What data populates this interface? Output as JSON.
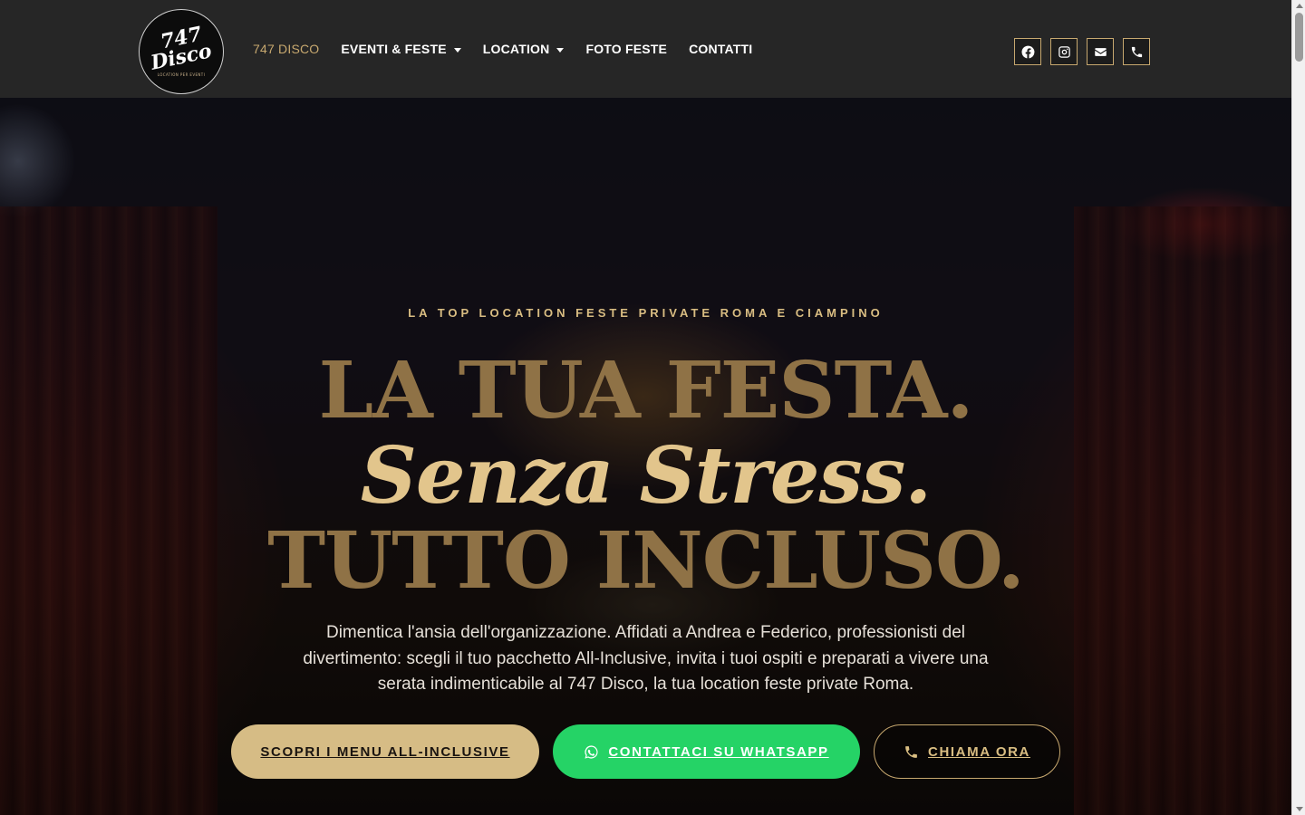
{
  "logo": {
    "line1": "747",
    "line2": "Disco",
    "tagline": "LOCATION PER EVENTI"
  },
  "nav": {
    "items": [
      {
        "label": "747 DISCO",
        "active": true,
        "dropdown": false
      },
      {
        "label": "EVENTI & FESTE",
        "active": false,
        "dropdown": true
      },
      {
        "label": "LOCATION",
        "active": false,
        "dropdown": true
      },
      {
        "label": "FOTO FESTE",
        "active": false,
        "dropdown": false
      },
      {
        "label": "CONTATTI",
        "active": false,
        "dropdown": false
      }
    ]
  },
  "socials": [
    "facebook-icon",
    "instagram-icon",
    "envelope-icon",
    "phone-icon"
  ],
  "hero": {
    "kicker": "LA TOP LOCATION FESTE PRIVATE ROMA E CIAMPINO",
    "headline1": "LA TUA FESTA.",
    "headline2": "Senza Stress.",
    "headline3": "TUTTO INCLUSO.",
    "description": "Dimentica l'ansia dell'organizzazione. Affidati a Andrea e Federico, professionisti del divertimento: scegli il tuo pacchetto All-Inclusive, invita i tuoi ospiti e preparati a vivere una serata indimenticabile al 747 Disco, la tua location feste private Roma."
  },
  "buttons": {
    "menu": "SCOPRI I MENU ALL-INCLUSIVE",
    "whatsapp": "CONTATTACI SU WHATSAPP",
    "call": "CHIAMA ORA"
  },
  "colors": {
    "header_bg": "#262626",
    "gold": "#c7a86f",
    "gold_light": "#d6bc85",
    "whatsapp_green": "#25d366"
  }
}
